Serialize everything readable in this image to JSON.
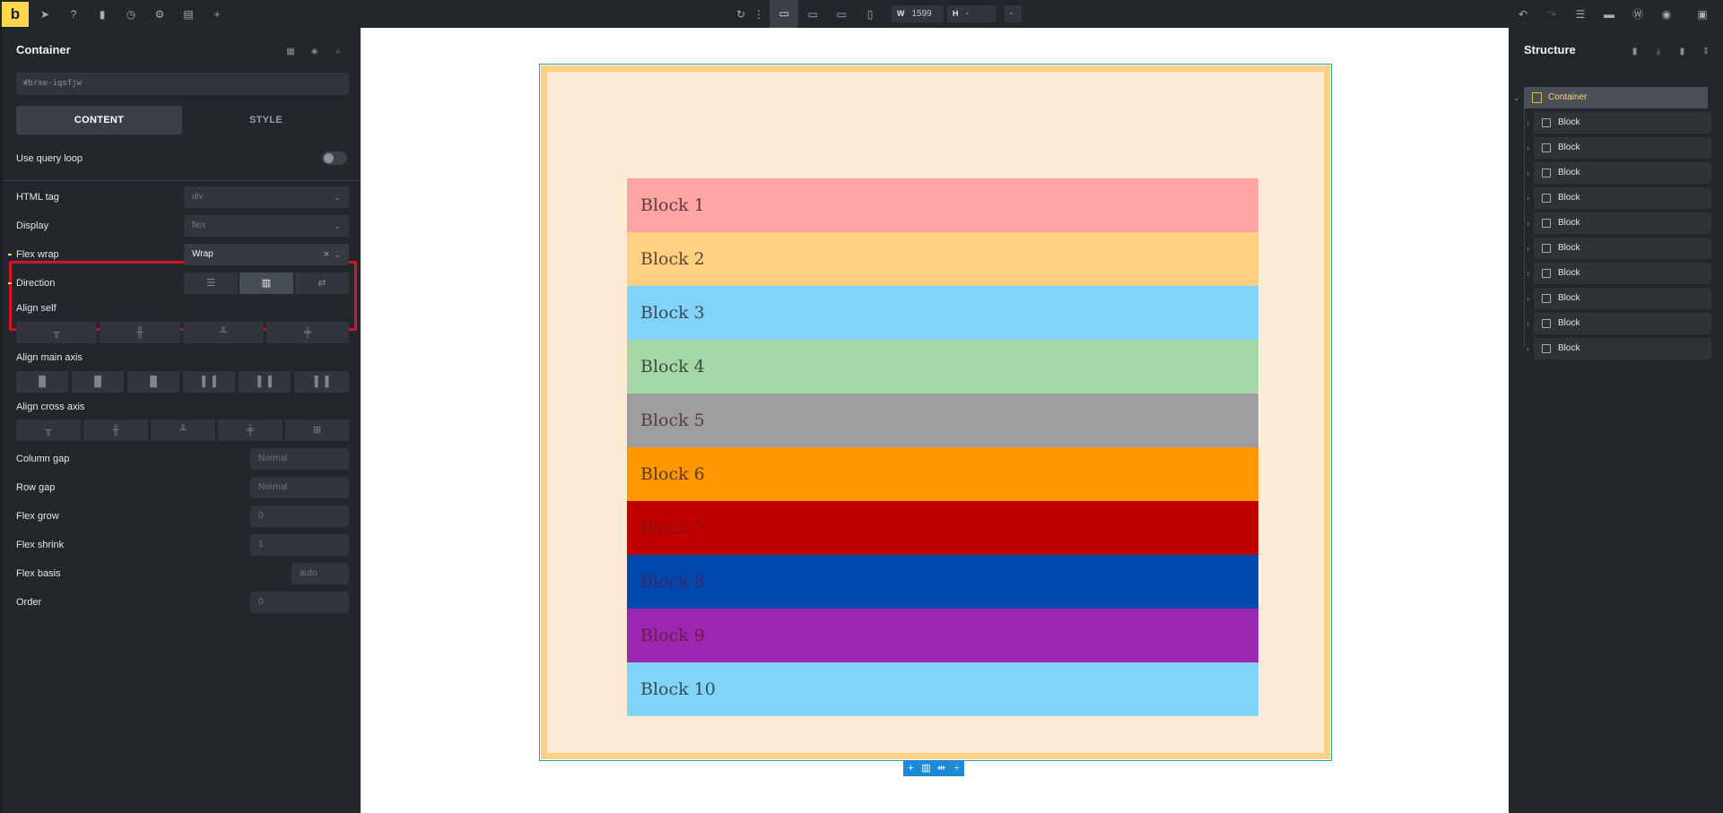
{
  "topbar": {
    "logo": "b",
    "width_label": "W",
    "width_value": "1599",
    "height_label": "H",
    "height_value": "-",
    "extra_value": "-"
  },
  "left_panel": {
    "title": "Container",
    "css_id": "#brxe-iqsfjw",
    "tabs": [
      "CONTENT",
      "STYLE"
    ],
    "use_query_loop": "Use query loop",
    "html_tag": {
      "label": "HTML tag",
      "value": "div"
    },
    "display": {
      "label": "Display",
      "value": "flex"
    },
    "flex_wrap": {
      "label": "Flex wrap",
      "value": "Wrap",
      "clear": "×"
    },
    "direction": {
      "label": "Direction"
    },
    "align_self": {
      "label": "Align self"
    },
    "align_main_axis": {
      "label": "Align main axis"
    },
    "align_cross_axis": {
      "label": "Align cross axis"
    },
    "column_gap": {
      "label": "Column gap",
      "placeholder": "Normal"
    },
    "row_gap": {
      "label": "Row gap",
      "placeholder": "Normal"
    },
    "flex_grow": {
      "label": "Flex grow",
      "placeholder": "0"
    },
    "flex_shrink": {
      "label": "Flex shrink",
      "placeholder": "1"
    },
    "flex_basis": {
      "label": "Flex basis",
      "placeholder": "auto"
    },
    "order": {
      "label": "Order",
      "placeholder": "0"
    }
  },
  "canvas": {
    "blocks": [
      {
        "label": "Block 1",
        "color": "#ffa3a3",
        "text_color": "#5a3c3c"
      },
      {
        "label": "Block 2",
        "color": "#ffd081",
        "text_color": "#5a4a30"
      },
      {
        "label": "Block 3",
        "color": "#82d3f9",
        "text_color": "#3a4a55"
      },
      {
        "label": "Block 4",
        "color": "#a3d7a5",
        "text_color": "#3a4c3a"
      },
      {
        "label": "Block 5",
        "color": "#9e9e9e",
        "text_color": "#5a3a3a"
      },
      {
        "label": "Block 6",
        "color": "#ff9800",
        "text_color": "#5a3a20"
      },
      {
        "label": "Block 7",
        "color": "#c10000",
        "text_color": "#8a1010"
      },
      {
        "label": "Block 8",
        "color": "#0047ab",
        "text_color": "#3a2a6a"
      },
      {
        "label": "Block 9",
        "color": "#9c27b0",
        "text_color": "#6a1a4a"
      },
      {
        "label": "Block 10",
        "color": "#82d3f9",
        "text_color": "#3a4a55"
      }
    ]
  },
  "right_panel": {
    "title": "Structure",
    "root": "Container",
    "items": [
      "Block",
      "Block",
      "Block",
      "Block",
      "Block",
      "Block",
      "Block",
      "Block",
      "Block",
      "Block"
    ]
  }
}
